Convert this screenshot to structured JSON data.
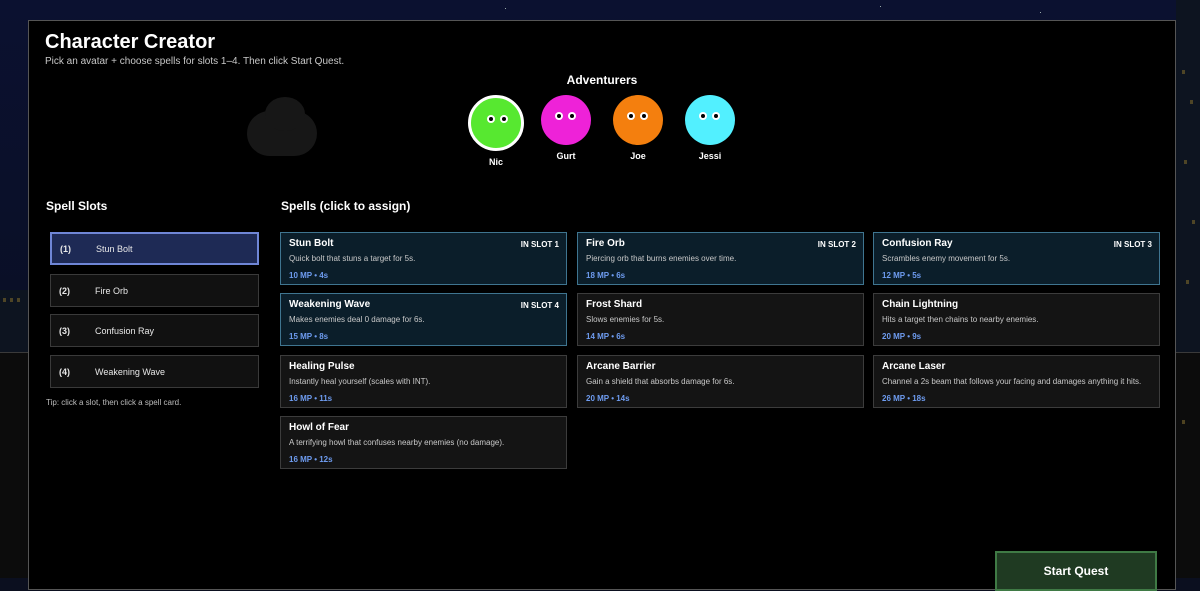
{
  "title": "Character Creator",
  "subtitle": "Pick an avatar + choose spells for slots 1–4. Then click Start Quest.",
  "adventurers": {
    "heading": "Adventurers",
    "items": [
      {
        "name": "Nic",
        "color": "#57e830",
        "selected": true
      },
      {
        "name": "Gurt",
        "color": "#ee22d8",
        "selected": false
      },
      {
        "name": "Joe",
        "color": "#f47f0e",
        "selected": false
      },
      {
        "name": "Jessi",
        "color": "#52f0ff",
        "selected": false
      }
    ]
  },
  "spell_slots": {
    "heading": "Spell Slots",
    "slots": [
      {
        "num": "(1)",
        "spell": "Stun Bolt",
        "active": true
      },
      {
        "num": "(2)",
        "spell": "Fire Orb",
        "active": false
      },
      {
        "num": "(3)",
        "spell": "Confusion Ray",
        "active": false
      },
      {
        "num": "(4)",
        "spell": "Weakening Wave",
        "active": false
      }
    ],
    "tip": "Tip: click a slot, then click a spell card."
  },
  "spells": {
    "heading": "Spells (click to assign)",
    "cards": [
      {
        "name": "Stun Bolt",
        "badge": "IN SLOT 1",
        "desc": "Quick bolt that stuns a target for 5s.",
        "stats": "10 MP • 4s"
      },
      {
        "name": "Fire Orb",
        "badge": "IN SLOT 2",
        "desc": "Piercing orb that burns enemies over time.",
        "stats": "18 MP • 6s"
      },
      {
        "name": "Confusion Ray",
        "badge": "IN SLOT 3",
        "desc": "Scrambles enemy movement for 5s.",
        "stats": "12 MP • 5s"
      },
      {
        "name": "Weakening Wave",
        "badge": "IN SLOT 4",
        "desc": "Makes enemies deal 0 damage for 6s.",
        "stats": "15 MP • 8s"
      },
      {
        "name": "Frost Shard",
        "badge": "",
        "desc": "Slows enemies for 5s.",
        "stats": "14 MP • 6s"
      },
      {
        "name": "Chain Lightning",
        "badge": "",
        "desc": "Hits a target then chains to nearby enemies.",
        "stats": "20 MP • 9s"
      },
      {
        "name": "Healing Pulse",
        "badge": "",
        "desc": "Instantly heal yourself (scales with INT).",
        "stats": "16 MP • 11s"
      },
      {
        "name": "Arcane Barrier",
        "badge": "",
        "desc": "Gain a shield that absorbs damage for 6s.",
        "stats": "20 MP • 14s"
      },
      {
        "name": "Arcane Laser",
        "badge": "",
        "desc": "Channel a 2s beam that follows your facing and damages anything it hits.",
        "stats": "26 MP • 18s"
      },
      {
        "name": "Howl of Fear",
        "badge": "",
        "desc": "A terrifying howl that confuses nearby enemies (no damage).",
        "stats": "16 MP • 12s"
      }
    ]
  },
  "start_button": "Start Quest"
}
